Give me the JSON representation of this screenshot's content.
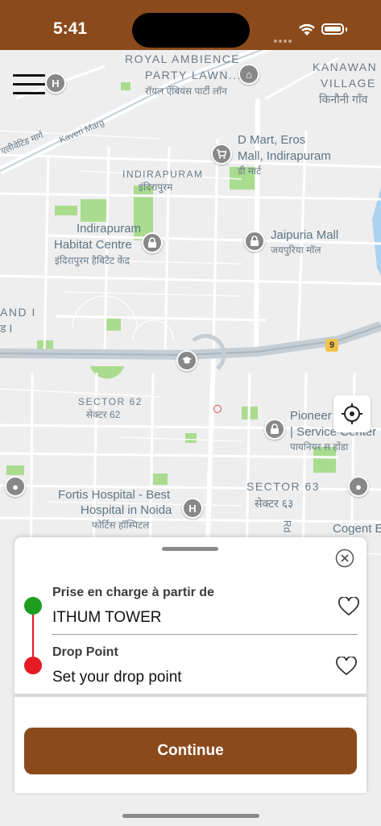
{
  "status_bar": {
    "time": "5:41"
  },
  "map": {
    "labels": {
      "royal_ambience": "ROYAL AMBIENCE",
      "party_lawn": "PARTY LAWN...",
      "royal_hindi": "रॉयल ऐंबियंस पार्टी लॉन",
      "kanawani": "KANAWAN",
      "village": "VILLAGE",
      "kanawani_hindi": "किनौनी गाँव",
      "kaveri": "Kaveri Marg",
      "elevated_hindi": "एलीवेटिड मार्ग",
      "dmart": "D Mart, Eros",
      "dmart2": "Mall, Indirapuram",
      "dmart_hindi": "डी मार्ट",
      "indirapuram": "INDIRAPURAM",
      "indirapuram_hindi": "इंदिरापुरम",
      "habitat1": "Indirapuram",
      "habitat2": "Habitat Centre",
      "habitat_hindi": "इंदिरापुरम हैबिटैट केंद्र",
      "jaipuria": "Jaipuria Mall",
      "jaipuria_hindi": "जयपुरिया मॉल",
      "and_i": "AND I",
      "and_i_hindi": "ड I",
      "sector62": "SECTOR 62",
      "sector62_hindi": "सेक्टर 62",
      "pioneer1": "Pioneer",
      "pioneer2": "| Service Center",
      "pioneer_hindi": "पायनियर स होंडा",
      "fortis1": "Fortis Hospital - Best",
      "fortis2": "Hospital in Noida",
      "fortis_hindi": "फोर्टिस हॉस्पिटल",
      "sector63": "SECTOR 63",
      "sector63_hindi": "सेक्टर ६३",
      "cogent": "Cogent E",
      "rd": "Rd",
      "road_badge": "9"
    }
  },
  "sheet": {
    "pickup_label": "Prise en charge à partir de",
    "pickup_value": "ITHUM TOWER",
    "drop_label": "Drop Point",
    "drop_value": "Set your drop point",
    "continue_label": "Continue"
  },
  "colors": {
    "brand": "#8b4a1c",
    "pickup": "#1e9e1e",
    "drop": "#e41b23"
  },
  "icons": [
    "menu-icon",
    "hospital-icon",
    "shopping-cart-icon",
    "lock-icon",
    "school-icon",
    "locate-icon",
    "close-icon",
    "heart-icon",
    "wifi-icon",
    "battery-icon"
  ]
}
